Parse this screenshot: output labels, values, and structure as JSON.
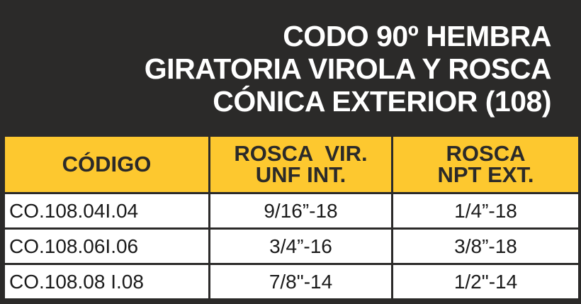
{
  "title": {
    "line1": "CODO 90º HEMBRA",
    "line2": "GIRATORIA VIROLA Y ROSCA",
    "line3": "CÓNICA EXTERIOR (108)"
  },
  "table": {
    "headers": [
      {
        "line1": "CÓDIGO",
        "line2": ""
      },
      {
        "line1": "ROSCA  VIR.",
        "line2": "UNF INT."
      },
      {
        "line1": "ROSCA",
        "line2": "NPT EXT."
      }
    ],
    "rows": [
      [
        "CO.108.04I.04",
        "9/16”-18",
        "1/4”-18"
      ],
      [
        "CO.108.06I.06",
        "3/4”-16",
        "3/8”-18"
      ],
      [
        "CO.108.08 I.08",
        "7/8\"-14",
        "1/2\"-14"
      ]
    ]
  },
  "colors": {
    "background": "#2b2a29",
    "header_fill": "#fdc82f",
    "cell_fill": "#ffffff"
  }
}
